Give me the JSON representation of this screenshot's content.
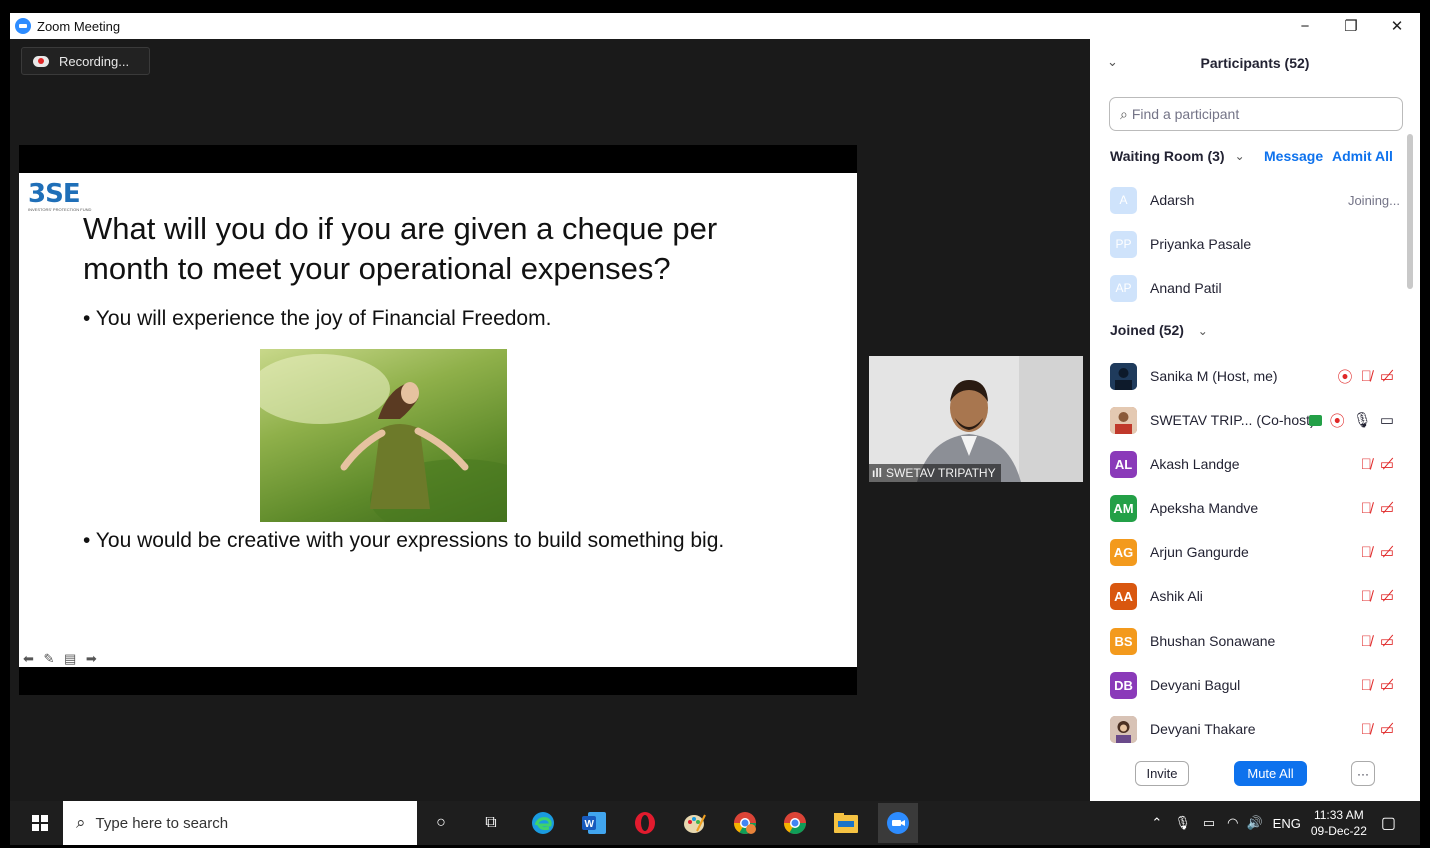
{
  "window": {
    "title": "Zoom Meeting",
    "controls": [
      "−",
      "❐",
      "✕"
    ]
  },
  "meeting": {
    "recording_label": "Recording...",
    "slide": {
      "logo": "3SE",
      "logo_tagline": "INVESTORS' PROTECTION FUND",
      "question_line1": "What will you do if you are given a cheque per",
      "question_line2": "month to meet your operational expenses?",
      "bullet1": "• You will experience the joy of Financial Freedom.",
      "bullet2": "• You would be creative with your expressions to build something big.",
      "controls": "⬅ ✎ ▤ ➡"
    },
    "video_tile": {
      "name": "SWETAV TRIPATHY",
      "signal": "ıll"
    }
  },
  "participants_panel": {
    "title": "Participants (52)",
    "collapse": "⌄",
    "search_placeholder": "Find a participant",
    "waiting_room": {
      "label": "Waiting Room (3)",
      "chevron": "⌄",
      "message": "Message",
      "admit_all": "Admit All",
      "people": [
        {
          "initials": "A",
          "name": "Adarsh",
          "status": "Joining..."
        },
        {
          "initials": "PP",
          "name": "Priyanka Pasale",
          "status": ""
        },
        {
          "initials": "AP",
          "name": "Anand Patil",
          "status": ""
        }
      ]
    },
    "joined": {
      "label": "Joined (52)",
      "chevron": "⌄",
      "people": [
        {
          "initials": "",
          "name": "Sanika M (Host, me)",
          "color": "#1f3b5c"
        },
        {
          "initials": "",
          "name": "SWETAV TRIP... (Co-host)",
          "color": "#c0714a"
        },
        {
          "initials": "AL",
          "name": "Akash Landge",
          "color": "#8a3ab9"
        },
        {
          "initials": "AM",
          "name": "Apeksha Mandve",
          "color": "#23a047"
        },
        {
          "initials": "AG",
          "name": "Arjun Gangurde",
          "color": "#f39a1d"
        },
        {
          "initials": "AA",
          "name": "Ashik Ali",
          "color": "#d9570f"
        },
        {
          "initials": "BS",
          "name": "Bhushan Sonawane",
          "color": "#f39a1d"
        },
        {
          "initials": "DB",
          "name": "Devyani Bagul",
          "color": "#8a3ab9"
        },
        {
          "initials": "",
          "name": "Devyani Thakare",
          "color": "#b48a72"
        }
      ]
    },
    "buttons": {
      "invite": "Invite",
      "mute_all": "Mute All",
      "more": "···"
    }
  },
  "taskbar": {
    "search_placeholder": "Type here to search",
    "lang": "ENG",
    "time": "11:33 AM",
    "date": "09-Dec-22"
  }
}
